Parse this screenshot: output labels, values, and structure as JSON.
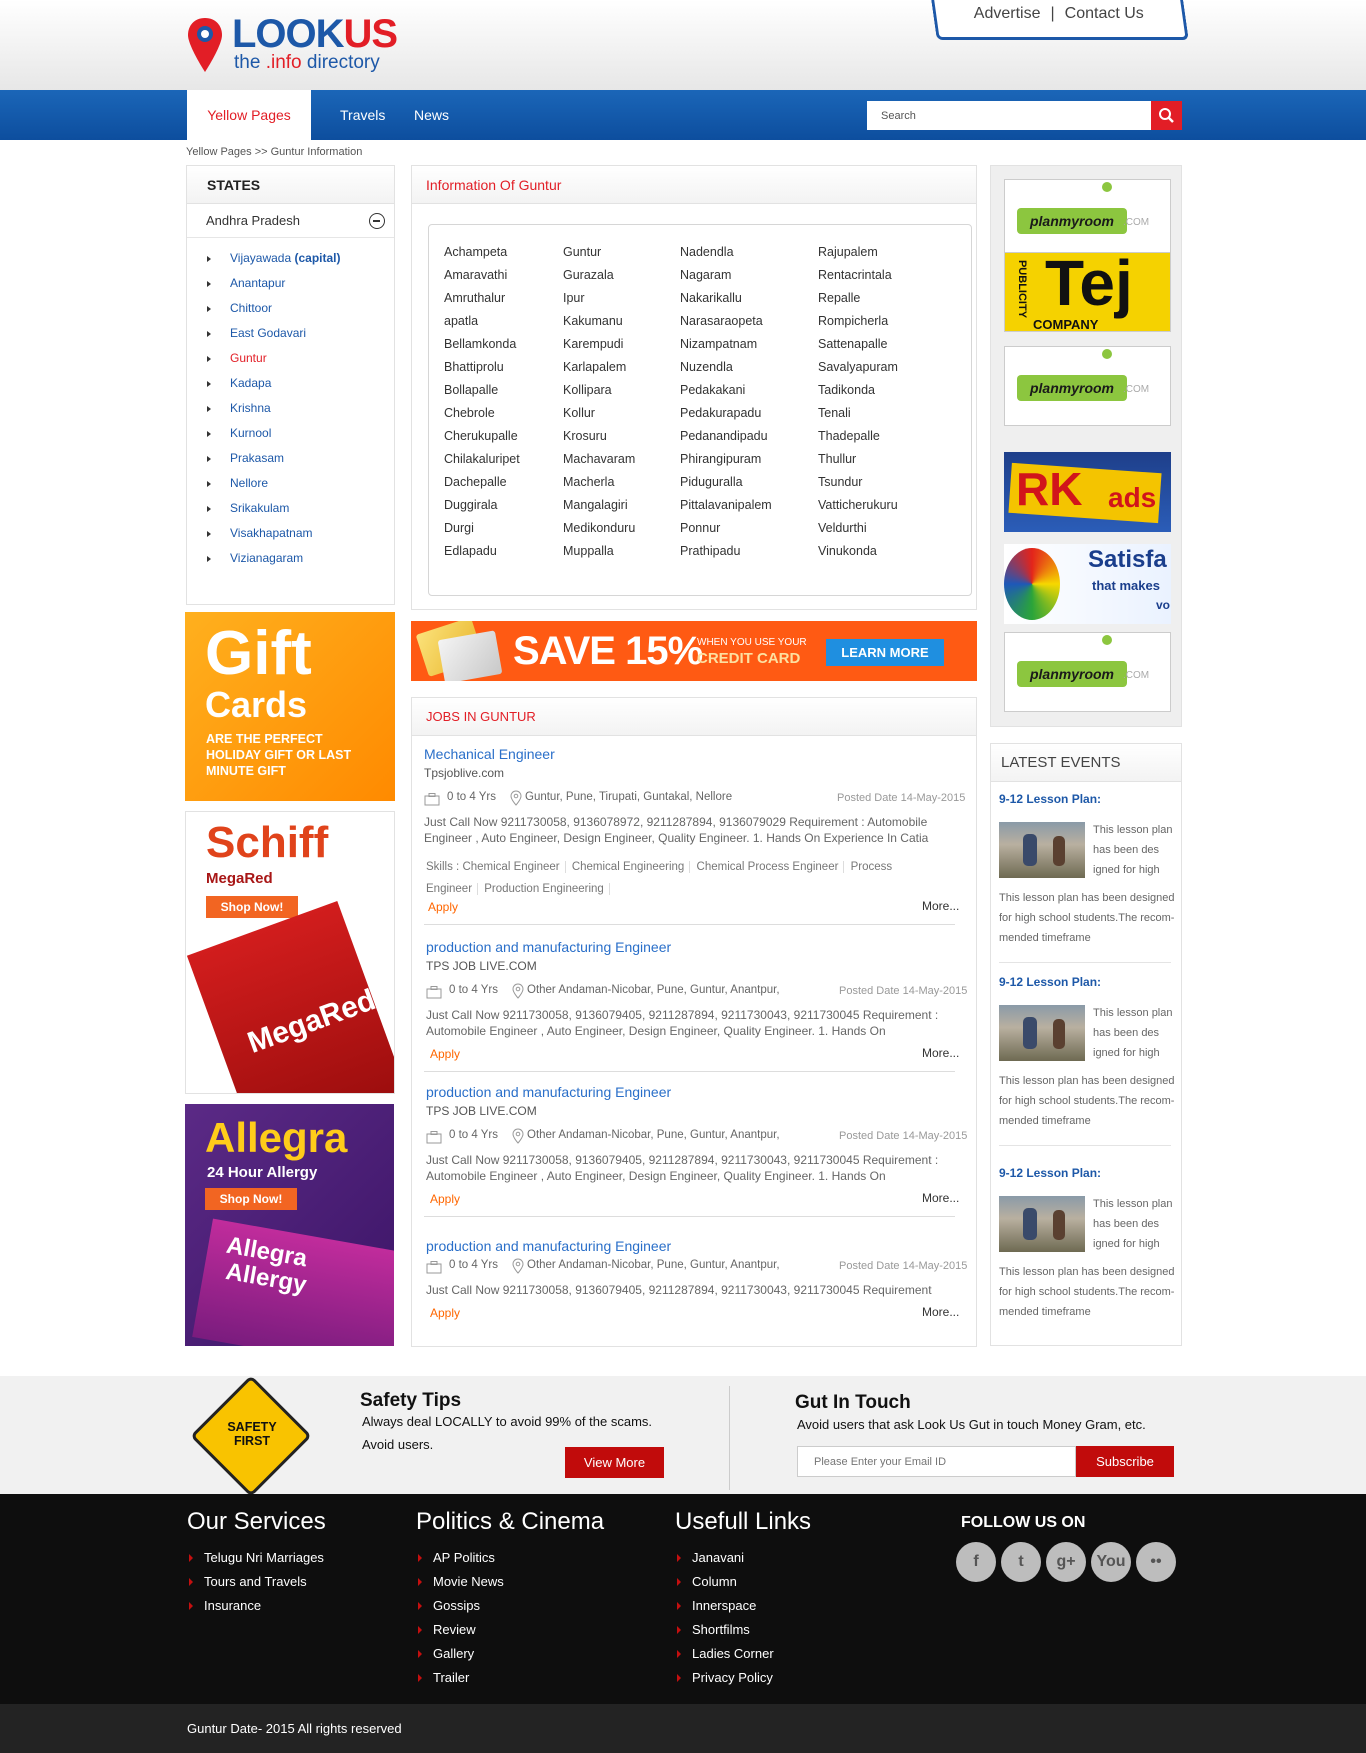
{
  "header": {
    "brand_main": "LOOK",
    "brand_accent": "US",
    "tagline_pre": "the ",
    "tagline_accent": ".info",
    "tagline_post": " directory",
    "advertise": "Advertise",
    "contact": "Contact Us",
    "divider": "|"
  },
  "nav": {
    "tabs": [
      "Yellow Pages",
      "Travels",
      "News"
    ],
    "active": "Yellow Pages",
    "search_placeholder": "Search"
  },
  "breadcrumb": "Yellow Pages >> Guntur Information",
  "states": {
    "title": "STATES",
    "state": "Andhra Pradesh",
    "districts": [
      {
        "name": "Vijayawada",
        "extra": "(capital)"
      },
      {
        "name": "Anantapur"
      },
      {
        "name": "Chittoor"
      },
      {
        "name": "East Godavari"
      },
      {
        "name": "Guntur",
        "current": true
      },
      {
        "name": "Kadapa"
      },
      {
        "name": "Krishna"
      },
      {
        "name": "Kurnool"
      },
      {
        "name": "Prakasam"
      },
      {
        "name": "Nellore"
      },
      {
        "name": "Srikakulam"
      },
      {
        "name": "Visakhapatnam"
      },
      {
        "name": "Vizianagaram"
      }
    ]
  },
  "info": {
    "title": "Information Of Guntur",
    "columns": [
      [
        "Achampeta",
        "Amaravathi",
        "Amruthalur",
        "apatla",
        "Bellamkonda",
        "Bhattiprolu",
        "Bollapalle",
        "Chebrole",
        "Cherukupalle",
        "Chilakaluripet",
        "Dachepalle",
        "Duggirala",
        "Durgi",
        "Edlapadu"
      ],
      [
        "Guntur",
        "Gurazala",
        "Ipur",
        "Kakumanu",
        "Karempudi",
        "Karlapalem",
        "Kollipara",
        "Kollur",
        "Krosuru",
        "Machavaram",
        "Macherla",
        "Mangalagiri",
        "Medikonduru",
        "Muppalla"
      ],
      [
        "Nadendla",
        "Nagaram",
        "Nakarikallu",
        "Narasaraopeta",
        "Nizampatnam",
        "Nuzendla",
        "Pedakakani",
        "Pedakurapadu",
        "Pedanandipadu",
        "Phirangipuram",
        "Piduguralla",
        "Pittalavanipalem",
        "Ponnur",
        "Prathipadu"
      ],
      [
        "Rajupalem",
        "Rentacrintala",
        "Repalle",
        "Rompicherla",
        "Sattenapalle",
        "Savalyapuram",
        "Tadikonda",
        "Tenali",
        "Thadepalle",
        "Thullur",
        "Tsundur",
        "Vatticherukuru",
        "Veldurthi",
        "Vinukonda"
      ]
    ]
  },
  "save_banner": {
    "headline": "SAVE 15%",
    "sub1": "WHEN YOU USE  YOUR",
    "sub2": "CREDIT CARD",
    "button": "LEARN MORE"
  },
  "ads_left": {
    "gift": {
      "title1": "Gift",
      "title2": "Cards",
      "text": "ARE THE PERFECT HOLIDAY GIFT OR LAST MINUTE GIFT"
    },
    "schiff": {
      "brand": "Schiff",
      "product": "MegaRed",
      "cta": "Shop Now!",
      "box": "MegaRed"
    },
    "allegra": {
      "brand": "Allegra",
      "sub": "24 Hour Allergy",
      "cta": "Shop Now!",
      "box1": "Allegra",
      "box2": "Allergy"
    }
  },
  "jobs": {
    "title": "JOBS IN GUNTUR",
    "more": "More...",
    "apply": "Apply",
    "items": [
      {
        "title": "Mechanical Engineer",
        "company": "Tpsjoblive.com",
        "exp": "0 to 4 Yrs",
        "loc": "Guntur, Pune, Tirupati, Guntakal, Nellore",
        "posted": "Posted Date 14-May-2015",
        "desc": "Just Call Now 9211730058, 9136078972, 9211287894, 9136079029 Requirement : Automobile Engineer , Auto Engineer, Design Engineer, Quality Engineer. 1. Hands On Experience In Catia",
        "skills_label": "Skills :",
        "skills": [
          "Chemical Engineer",
          "Chemical Engineering",
          "Chemical Process Engineer",
          "Process Engineer",
          "Production Engineering"
        ]
      },
      {
        "title": "production and manufacturing Engineer",
        "company": "TPS JOB LIVE.COM",
        "exp": "0 to 4 Yrs",
        "loc": "Other Andaman-Nicobar, Pune, Guntur, Anantpur,",
        "posted": "Posted Date 14-May-2015",
        "desc": "Just Call Now 9211730058, 9136079405, 9211287894, 9211730043, 9211730045 Requirement : Automobile Engineer , Auto Engineer, Design Engineer, Quality Engineer. 1. Hands On"
      },
      {
        "title": "production and manufacturing Engineer",
        "company": "TPS JOB LIVE.COM",
        "exp": "0 to 4 Yrs",
        "loc": "Other Andaman-Nicobar, Pune, Guntur, Anantpur,",
        "posted": "Posted Date 14-May-2015",
        "desc": "Just Call Now 9211730058, 9136079405, 9211287894, 9211730043, 9211730045 Requirement : Automobile Engineer , Auto Engineer, Design Engineer, Quality Engineer. 1. Hands On"
      },
      {
        "title": "production and manufacturing Engineer",
        "exp": "0 to 4 Yrs",
        "loc": "Other Andaman-Nicobar, Pune, Guntur, Anantpur,",
        "posted": "Posted Date 14-May-2015",
        "desc": "Just Call Now 9211730058, 9136079405, 9211287894, 9211730043, 9211730045 Requirement"
      }
    ]
  },
  "ads_right": {
    "plan": "planmyroom",
    "plan_suffix": ".COM",
    "tej_side": "PUBLICITY",
    "tej": "Tej",
    "tej_sub": "COMPANY",
    "rk": "RK",
    "rk_sub": "ads",
    "sat": "Satisfa",
    "sat_sub": "that makes",
    "sat_tail": "vo"
  },
  "events": {
    "title": "LATEST EVENTS",
    "items": [
      {
        "title": "9-12 Lesson Plan:",
        "short": "This lesson plan has been des igned for high",
        "body": "This lesson plan has been designed for high school students.The recom-mended timeframe"
      },
      {
        "title": "9-12 Lesson Plan:",
        "short": "This lesson plan has been des igned for high",
        "body": "This lesson plan has been designed for high school students.The recom-mended timeframe"
      },
      {
        "title": "9-12 Lesson Plan:",
        "short": "This lesson plan has been des igned for high",
        "body": "This lesson plan has been designed for high school students.The recom-mended timeframe"
      }
    ]
  },
  "safety": {
    "sign1": "SAFETY",
    "sign2": "FIRST",
    "title": "Safety Tips",
    "line1": "Always deal LOCALLY to avoid 99% of the scams.",
    "line2": "Avoid users.",
    "button": "View More"
  },
  "touch": {
    "title": "Gut In Touch",
    "line": "Avoid users that ask Look Us  Gut in touch Money Gram, etc.",
    "placeholder": "Please Enter your Email ID",
    "button": "Subscribe"
  },
  "footer": {
    "services": {
      "title": "Our Services",
      "links": [
        "Telugu Nri Marriages",
        "Tours and Travels",
        "Insurance"
      ]
    },
    "politics": {
      "title": "Politics & Cinema",
      "links": [
        "AP Politics",
        "Movie News",
        "Gossips",
        "Review",
        "Gallery",
        "Trailer"
      ]
    },
    "useful": {
      "title": "Usefull Links",
      "links": [
        "Janavani",
        "Column",
        "Innerspace",
        "Shortfilms",
        "Ladies Corner",
        "Privacy Policy"
      ]
    },
    "follow": {
      "title": "FOLLOW US ON",
      "icons": [
        "facebook-icon",
        "twitter-icon",
        "googleplus-icon",
        "youtube-icon",
        "flickr-icon"
      ],
      "glyphs": [
        "f",
        "t",
        "g+",
        "You",
        "••"
      ]
    },
    "copyright": "Guntur Date- 2015 All rights reserved"
  }
}
